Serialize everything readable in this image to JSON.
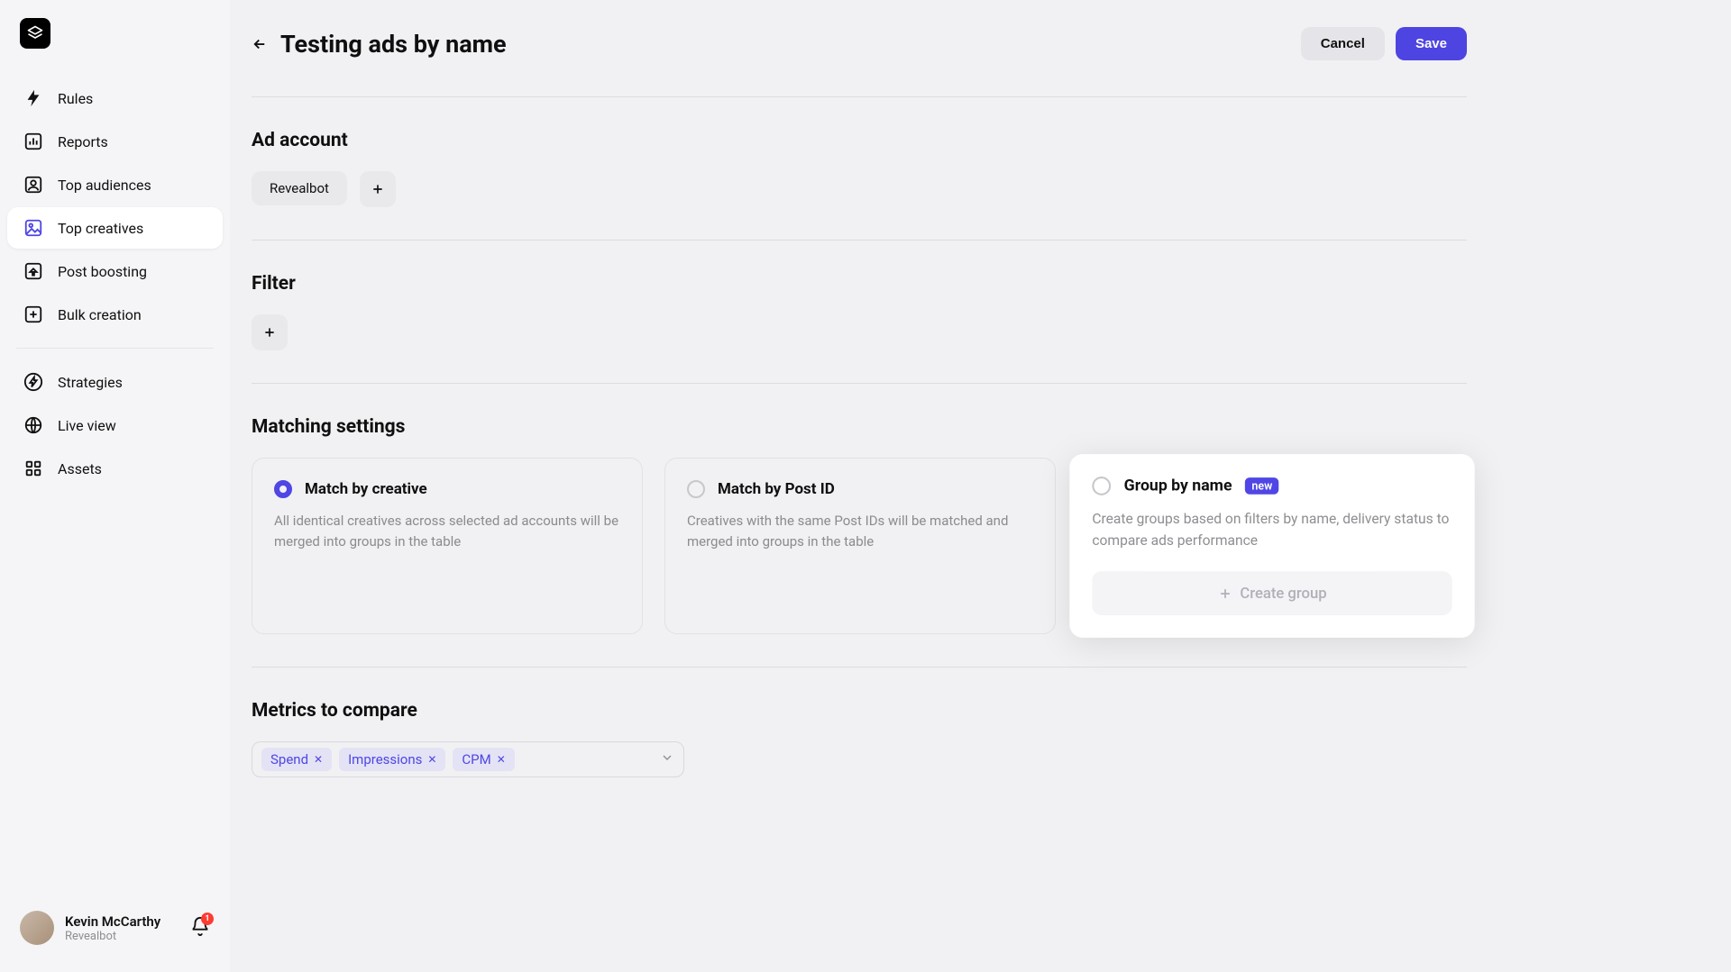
{
  "sidebar": {
    "items": [
      {
        "label": "Rules"
      },
      {
        "label": "Reports"
      },
      {
        "label": "Top audiences"
      },
      {
        "label": "Top creatives"
      },
      {
        "label": "Post boosting"
      },
      {
        "label": "Bulk creation"
      },
      {
        "label": "Strategies"
      },
      {
        "label": "Live view"
      },
      {
        "label": "Assets"
      }
    ]
  },
  "user": {
    "name": "Kevin McCarthy",
    "org": "Revealbot",
    "notifications": "1"
  },
  "header": {
    "title": "Testing ads by name",
    "cancel_label": "Cancel",
    "save_label": "Save"
  },
  "ad_account": {
    "title": "Ad account",
    "selected": "Revealbot"
  },
  "filter": {
    "title": "Filter"
  },
  "matching": {
    "title": "Matching settings",
    "options": [
      {
        "label": "Match by creative",
        "desc": "All identical creatives across selected ad accounts will be merged into groups in the table"
      },
      {
        "label": "Match by Post ID",
        "desc": "Creatives with the same Post IDs will be matched and merged into groups in the table"
      },
      {
        "label": "Group by name",
        "badge": "new",
        "desc": "Create groups based on filters by name, delivery status to compare ads performance",
        "create_label": "Create group"
      }
    ]
  },
  "metrics": {
    "title": "Metrics to compare",
    "tags": [
      "Spend",
      "Impressions",
      "CPM"
    ]
  }
}
